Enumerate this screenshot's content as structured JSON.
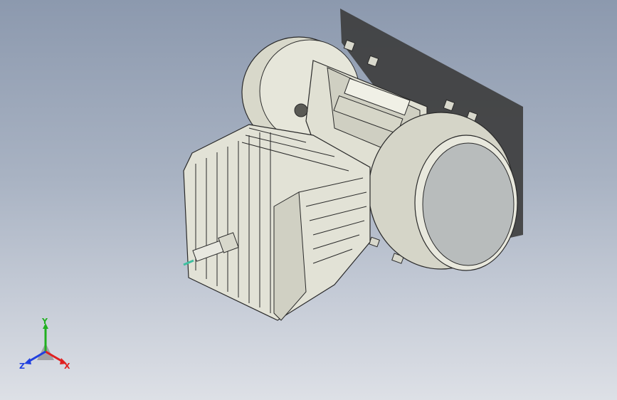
{
  "viewport": {
    "background_top": "#8c99ae",
    "background_bottom": "#dde0e6",
    "model_body_color": "#e4e4d8",
    "model_edge_color": "#2a2a2a",
    "shadow_color": "#3c3c3c",
    "spark_tip_color": "#3fbfa0"
  },
  "model": {
    "parts": [
      "cylinder-head",
      "cooling-fins",
      "spark-plug",
      "crankcase",
      "flywheel-cover-left",
      "flywheel-cover-right",
      "mounting-tabs"
    ]
  },
  "triad": {
    "x_label": "X",
    "y_label": "Y",
    "z_label": "Z",
    "x_color": "#e02020",
    "y_color": "#20b020",
    "z_color": "#2040e0"
  }
}
